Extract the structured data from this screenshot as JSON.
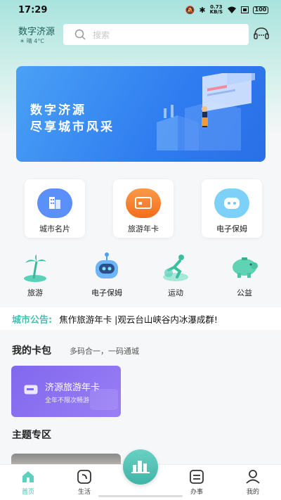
{
  "status": {
    "time": "17:29",
    "net_speed": "0.73",
    "net_unit": "KB/S",
    "battery": "100"
  },
  "header": {
    "city": "数字济源",
    "weather": "☀ 晴 4°C"
  },
  "search": {
    "placeholder": "搜索"
  },
  "banner": {
    "title": "数字济源",
    "subtitle": "尽享城市风采"
  },
  "tiles": [
    {
      "label": "城市名片",
      "color": "#5b8ff9"
    },
    {
      "label": "旅游年卡",
      "color": "#f7832e"
    },
    {
      "label": "电子保姆",
      "color": "#6cc9f5"
    }
  ],
  "categories": [
    {
      "label": "旅游"
    },
    {
      "label": "电子保姆"
    },
    {
      "label": "运动"
    },
    {
      "label": "公益"
    }
  ],
  "notice": {
    "tag": "城市公告:",
    "text": "焦作旅游年卡 |观云台山峡谷内冰瀑成群!"
  },
  "wallet": {
    "title": "我的卡包",
    "subtitle": "多码合一，一码通城",
    "card_title": "济源旅游年卡",
    "card_sub": "全年不限次畅游"
  },
  "theme": {
    "title": "主题专区"
  },
  "tabbar": [
    {
      "label": "首页",
      "active": true
    },
    {
      "label": "生活",
      "active": false
    },
    {
      "label": "办事",
      "active": false
    },
    {
      "label": "我的",
      "active": false
    }
  ],
  "colors": {
    "accent": "#46bdb0",
    "banner": "#2f7cf0",
    "card": "#8068ee"
  }
}
